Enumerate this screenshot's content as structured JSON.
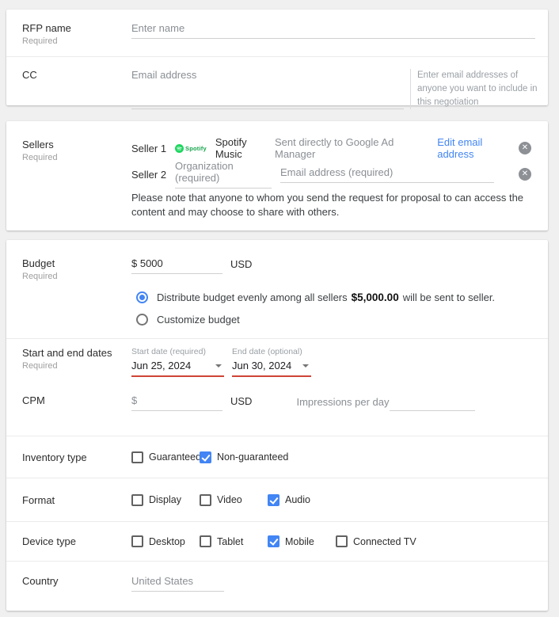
{
  "colors": {
    "accent_blue": "#4285f4",
    "error_red": "#cf4437",
    "spotify_green": "#1ED760"
  },
  "rfp": {
    "label": "RFP name",
    "required": "Required",
    "placeholder": "Enter name"
  },
  "cc": {
    "label": "CC",
    "placeholder": "Email address",
    "helper": "Enter email addresses of anyone you want to include in this negotiation"
  },
  "sellers": {
    "label": "Sellers",
    "required": "Required",
    "seller1": {
      "label": "Seller 1",
      "brand": "Spotify",
      "name": "Spotify Music",
      "status": "Sent directly to Google Ad Manager",
      "edit_link": "Edit email address",
      "close": "✕"
    },
    "seller2": {
      "label": "Seller 2",
      "org_placeholder": "Organization (required)",
      "email_placeholder": "Email address (required)",
      "close": "✕"
    },
    "note": "Please note that anyone to whom you send the request for proposal to can access the content and may choose to share with others."
  },
  "budget": {
    "label": "Budget",
    "required": "Required",
    "amount": "$ 5000",
    "currency": "USD",
    "options": [
      {
        "label": "Distribute budget evenly among all sellers",
        "amount": "$5,000.00",
        "suffix": "will be sent to seller.",
        "selected": true
      },
      {
        "label": "Customize budget",
        "selected": false
      }
    ]
  },
  "dates": {
    "label": "Start and end dates",
    "required": "Required",
    "start": {
      "label": "Start date (required)",
      "value": "Jun 25, 2024"
    },
    "end": {
      "label": "End date (optional)",
      "value": "Jun 30, 2024"
    }
  },
  "cpm": {
    "label": "CPM",
    "amount_placeholder": "$",
    "currency": "USD",
    "impressions_label": "Impressions per day"
  },
  "inventory": {
    "label": "Inventory type",
    "options": [
      {
        "label": "Guaranteed",
        "checked": false
      },
      {
        "label": "Non-guaranteed",
        "checked": true
      }
    ]
  },
  "format": {
    "label": "Format",
    "options": [
      {
        "label": "Display",
        "checked": false
      },
      {
        "label": "Video",
        "checked": false
      },
      {
        "label": "Audio",
        "checked": true
      }
    ]
  },
  "device": {
    "label": "Device type",
    "options": [
      {
        "label": "Desktop",
        "checked": false
      },
      {
        "label": "Tablet",
        "checked": false
      },
      {
        "label": "Mobile",
        "checked": true
      },
      {
        "label": "Connected TV",
        "checked": false
      }
    ]
  },
  "country": {
    "label": "Country",
    "value": "United States"
  }
}
